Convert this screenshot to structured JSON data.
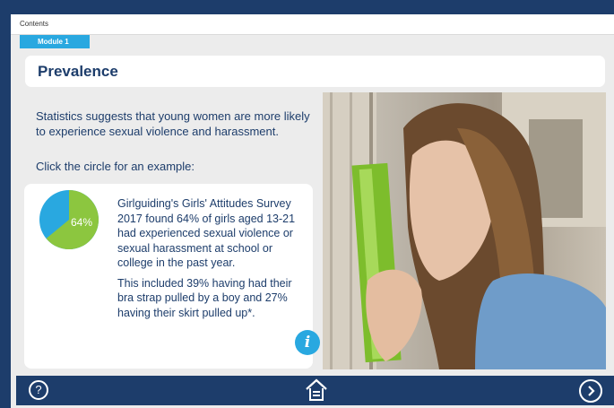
{
  "topbar": {
    "contents_label": "Contents"
  },
  "module": {
    "tab_label": "Module 1"
  },
  "page": {
    "title": "Prevalence"
  },
  "content": {
    "intro": "Statistics suggests that young women are more likely to experience sexual violence and harassment.",
    "prompt": "Click the circle for an example:",
    "pie": {
      "label": "64%",
      "value_percent": 64,
      "color_main": "#8cc63f",
      "color_rest": "#29a8e0"
    },
    "stat_paragraph_1": "Girlguiding's Girls' Attitudes Survey 2017 found 64% of girls aged 13-21 had experienced sexual violence or sexual harassment at school or college in the past year.",
    "stat_paragraph_2": "This included 39% having had their bra strap pulled by a boy and 27% having their skirt pulled up*.",
    "info_icon": "info-icon"
  },
  "photo": {
    "subject": "upset young woman leaning head against lockers"
  },
  "footer": {
    "help_icon": "help-icon",
    "home_icon": "home-icon",
    "next_icon": "next-icon"
  },
  "colors": {
    "navy": "#1d3d6b",
    "accent": "#29a8e0",
    "green": "#8cc63f"
  }
}
